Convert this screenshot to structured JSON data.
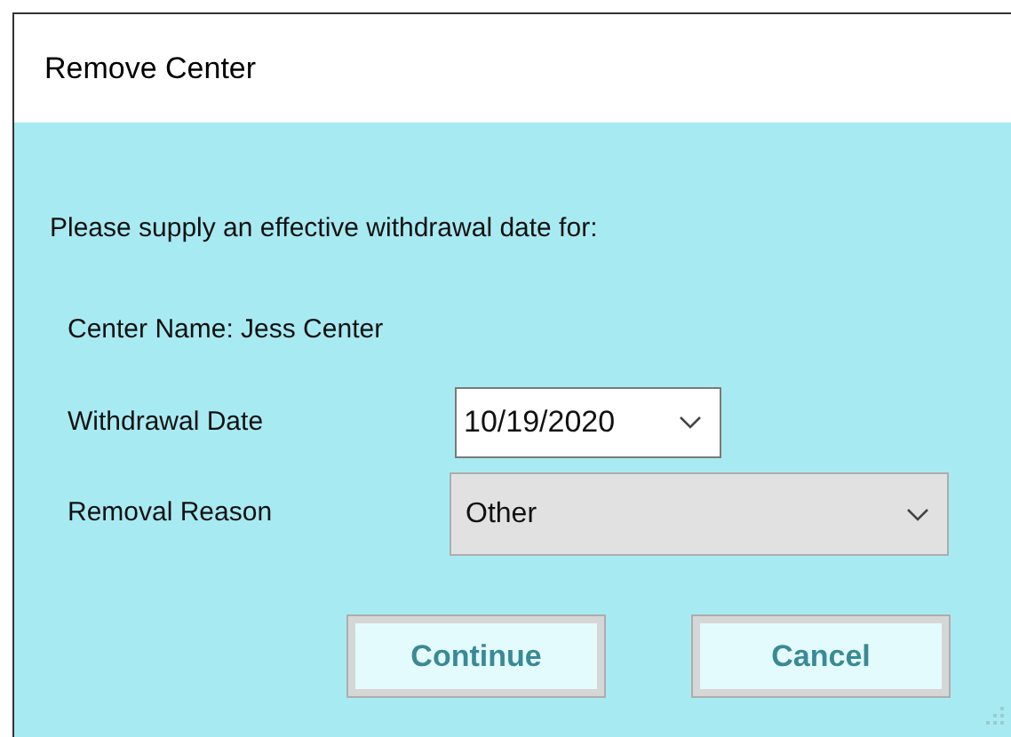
{
  "window": {
    "title": "Remove Center"
  },
  "prompt": "Please supply an effective withdrawal date for:",
  "center_name": "Center Name: Jess Center",
  "fields": [
    {
      "label": "Withdrawal Date",
      "value": "10/19/2020",
      "kind": "date"
    },
    {
      "label": "Removal Reason",
      "value": "Other",
      "kind": "select"
    }
  ],
  "buttons": [
    "Continue",
    "Cancel"
  ]
}
